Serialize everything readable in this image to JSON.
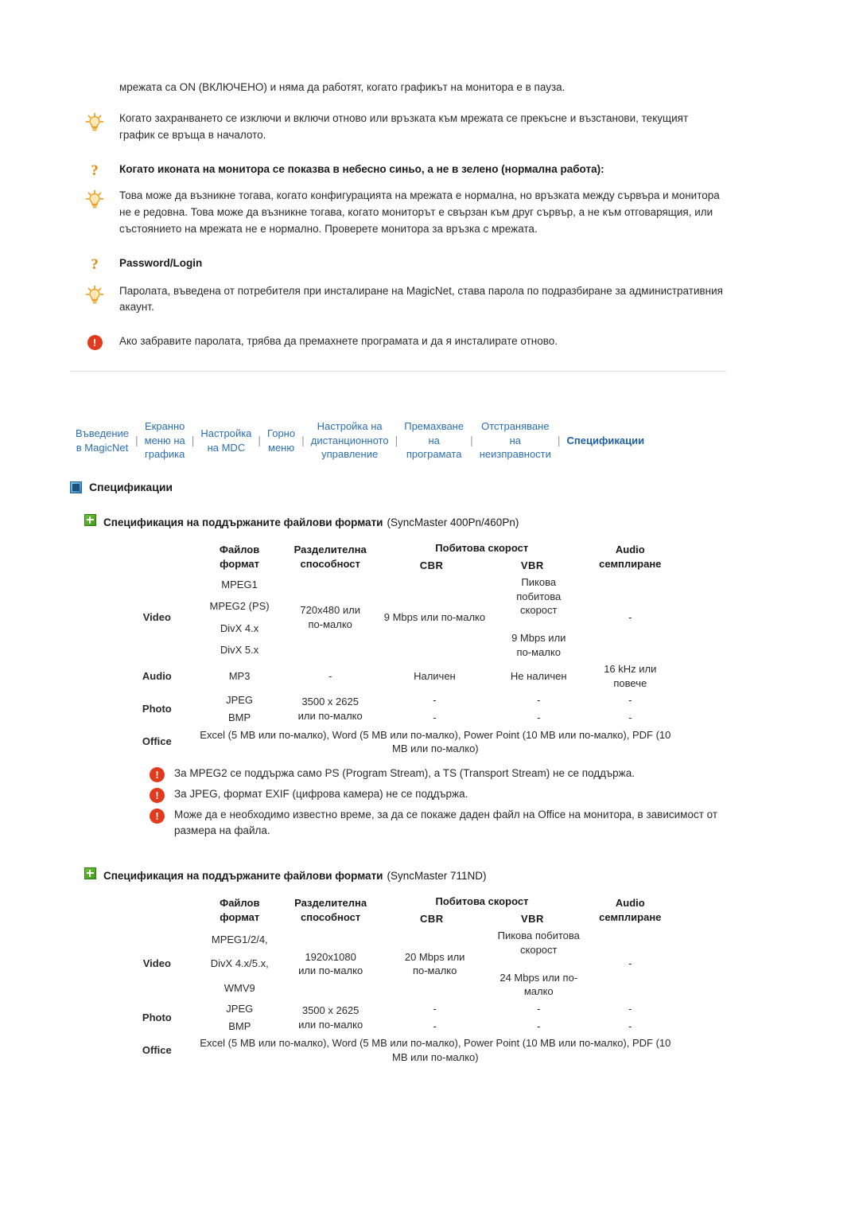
{
  "faq": [
    {
      "icon": "none",
      "text": "мрежата са ON (ВКЛЮЧЕНО) и няма да работят, когато графикът на монитора е в пауза."
    },
    {
      "icon": "bulb-icon",
      "text": "Когато захранването се изключи и включи отново или връзката към мрежата се прекъсне и възстанови, текущият график се връща в началото."
    },
    {
      "icon": "question-icon",
      "heading": "Когато иконата на монитора се показва в небесно синьо, а не в зелено (нормална работа):"
    },
    {
      "icon": "bulb-icon",
      "text": "Това може да възникне тогава, когато конфигурацията на мрежата е нормална, но връзката между сървъра и монитора не е редовна. Това може да възникне тогава, когато мониторът е свързан към друг сървър, а не към отговарящия, или състоянието на мрежата не е нормално. Проверете монитора за връзка с мрежата."
    },
    {
      "icon": "question-icon",
      "heading": "Password/Login"
    },
    {
      "icon": "bulb-icon",
      "text": "Паролата, въведена от потребителя при инсталиране на MagicNet, става парола по подразбиране за административния акаунт."
    },
    {
      "icon": "exclamation-icon",
      "text": "Ако забравите паролата, трябва да премахнете програмата и да я инсталирате отново."
    }
  ],
  "nav": {
    "items": [
      {
        "label": "Въведение\nв MagicNet",
        "selected": false
      },
      {
        "label": "Екранно\nменю на\nграфика",
        "selected": false
      },
      {
        "label": "Настройка\nна MDC",
        "selected": false
      },
      {
        "label": "Горно\nменю",
        "selected": false
      },
      {
        "label": "Настройка на\nдистанционното\nуправление",
        "selected": false
      },
      {
        "label": "Премахване\nна\nпрограмата",
        "selected": false
      },
      {
        "label": "Отстраняване\nна\nнеизправности",
        "selected": false
      },
      {
        "label": "Спецификации",
        "selected": true
      }
    ],
    "divider": "|"
  },
  "section": {
    "title": "Спецификации"
  },
  "table1": {
    "heading_bold": "Спецификация на поддържаните файлови формати",
    "heading_normal": "(SyncMaster 400Pn/460Pn)",
    "headers": {
      "col1_line1": "Файлов",
      "col1_line2": "формат",
      "col2_line1": "Разделителна",
      "col2_line2": "способност",
      "col3_top": "Побитова скорост",
      "col3_cbr": "CBR",
      "col4_vbr": "VBR",
      "col5_top": "Audio",
      "col5_line2": "семплиране"
    },
    "rows": [
      {
        "label": "Video",
        "formats": [
          "MPEG1",
          "MPEG2 (PS)",
          "DivX 4.x",
          "DivX 5.x"
        ],
        "resolution": "720x480 или\nпо-малко",
        "cbr": "9 Mbps или по-малко",
        "vbr": "Пикова\nпобитова\nскорост\n\n9 Mbps или\nпо-малко",
        "audio": "-"
      },
      {
        "label": "Audio",
        "formats": [
          "MP3"
        ],
        "resolution": "-",
        "cbr": "Наличен",
        "vbr": "Не наличен",
        "audio": "16 kHz или\nповече"
      },
      {
        "label": "Photo",
        "formats": [
          "JPEG",
          "BMP"
        ],
        "resolution": "3500 x 2625\nили по-малко",
        "cbr": "-",
        "vbr": "-",
        "audio": "-"
      }
    ],
    "office_label": "Office",
    "office_text": "Excel (5 MB или по-малко), Word (5 MB или по-малко), Power Point (10 MB или по-малко), PDF (10 MB или по-малко)"
  },
  "notes": [
    "За MPEG2 се поддържа само PS (Program Stream), a TS (Transport Stream) не се поддържа.",
    "За JPEG, формат EXIF (цифрова камера) не се поддържа.",
    "Може да е необходимо известно време, за да се покаже даден файл на Office на монитора, в зависимост от размера на файла."
  ],
  "table2": {
    "heading_bold": "Спецификация на поддържаните файлови формати",
    "heading_normal": "(SyncMaster 711ND)",
    "headers": {
      "col1_line1": "Файлов",
      "col1_line2": "формат",
      "col2_line1": "Разделителна",
      "col2_line2": "способност",
      "col3_top": "Побитова скорост",
      "col3_cbr": "CBR",
      "col4_vbr": "VBR",
      "col5_top": "Audio",
      "col5_line2": "семплиране"
    },
    "rows": [
      {
        "label": "Video",
        "formats": [
          "MPEG1/2/4,",
          "DivX 4.x/5.x,",
          "WMV9"
        ],
        "resolution": "1920x1080\nили по-малко",
        "cbr": "20 Mbps или\nпо-малко",
        "vbr": "Пикова побитова\nскорост\n\n24 Mbps или по-\nмалко",
        "audio": "-"
      },
      {
        "label": "Photo",
        "formats": [
          "JPEG",
          "BMP"
        ],
        "resolution": "3500 x 2625\nили по-малко",
        "cbr": "-",
        "vbr": "-",
        "audio": "-"
      }
    ],
    "office_label": "Office",
    "office_text": "Excel (5 MB или по-малко), Word (5 MB или по-малко), Power Point (10 MB или по-малко), PDF (10 MB или по-малко)"
  }
}
